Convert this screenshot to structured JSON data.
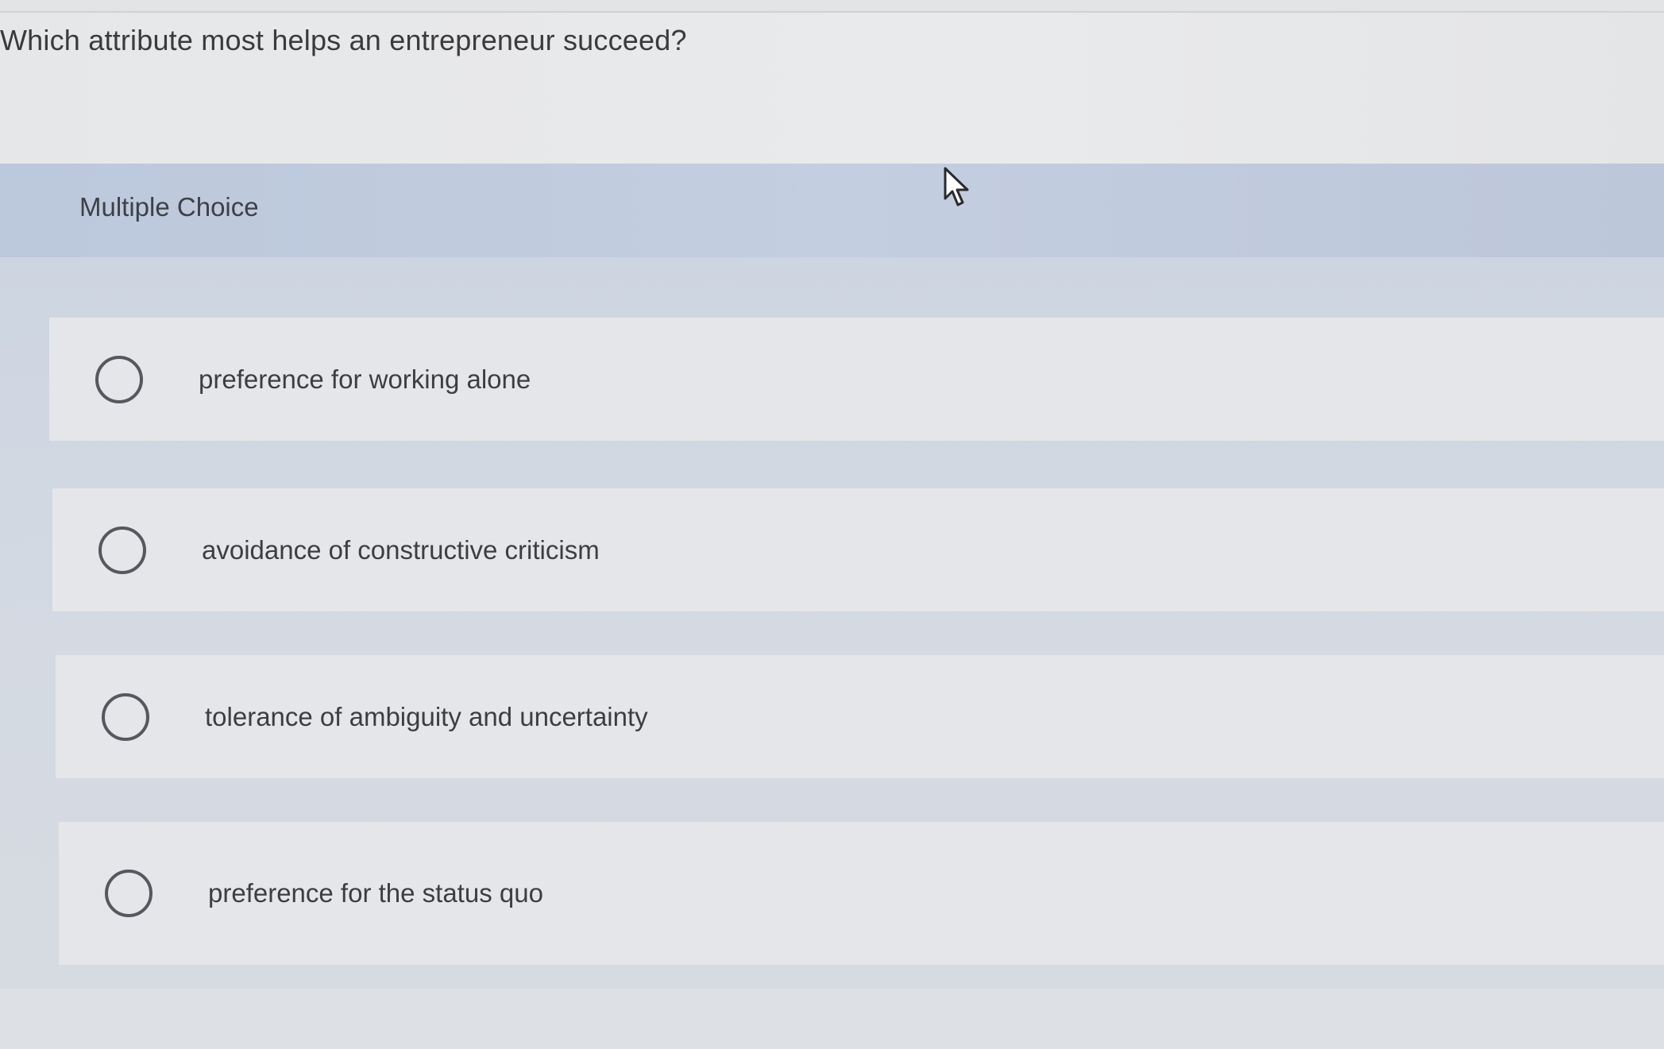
{
  "question": {
    "text": "Which attribute most helps an entrepreneur succeed?"
  },
  "question_type": {
    "label": "Multiple Choice"
  },
  "options": [
    {
      "text": "preference for working alone",
      "selected": false
    },
    {
      "text": "avoidance of constructive criticism",
      "selected": false
    },
    {
      "text": "tolerance of ambiguity and uncertainty",
      "selected": false
    },
    {
      "text": "preference for the status quo",
      "selected": false
    }
  ],
  "icons": {
    "cursor": "mouse-pointer-icon",
    "radio": "radio-unselected-icon"
  },
  "colors": {
    "header_band": "#bcc8db",
    "option_bg": "#e4e6e9",
    "text": "#3c3e42"
  }
}
